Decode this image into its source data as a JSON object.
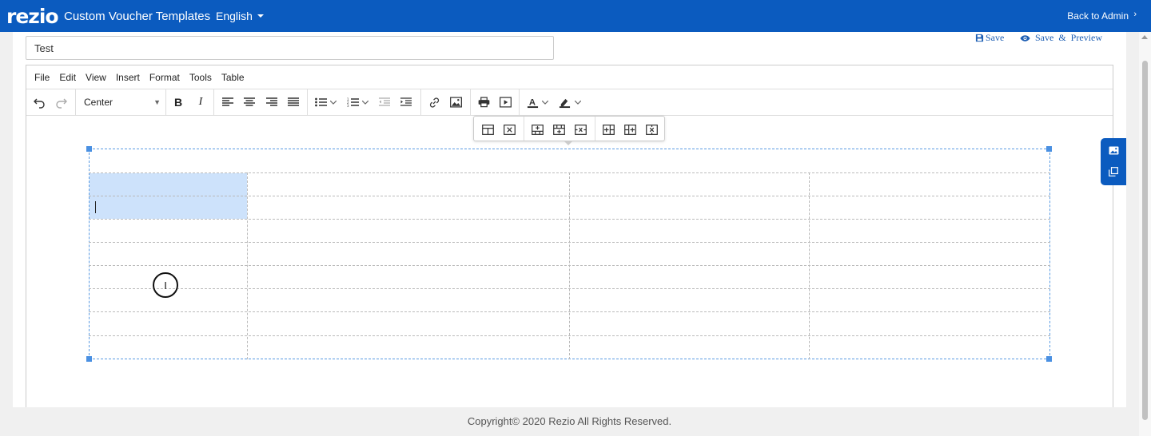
{
  "header": {
    "logo": "rezio",
    "title": "Custom Voucher Templates",
    "language": "English",
    "back_link": "Back to Admin"
  },
  "form": {
    "template_name": "Test",
    "save_label": "Save",
    "preview_label": "Save & Preview"
  },
  "editor": {
    "menu": [
      "File",
      "Edit",
      "View",
      "Insert",
      "Format",
      "Tools",
      "Table"
    ],
    "block_format": "Center",
    "toolbar_icons": [
      "undo-icon",
      "redo-icon",
      "bold-icon",
      "italic-icon",
      "align-left-icon",
      "align-center-icon",
      "align-right-icon",
      "align-justify-icon",
      "bullet-list-icon",
      "numbered-list-icon",
      "outdent-icon",
      "indent-icon",
      "link-icon",
      "image-icon",
      "print-icon",
      "media-icon",
      "text-color-icon",
      "highlight-color-icon"
    ],
    "table_context_icons": [
      "table-properties-icon",
      "delete-table-icon",
      "insert-row-before-icon",
      "insert-row-after-icon",
      "delete-row-icon",
      "insert-column-before-icon",
      "insert-column-after-icon",
      "delete-column-icon"
    ],
    "table": {
      "rows": 9,
      "columns": 4,
      "selected_cells": [
        [
          1,
          0
        ],
        [
          2,
          0
        ]
      ]
    }
  },
  "side_widget_icons": [
    "image-icon",
    "copy-icon"
  ],
  "footer": {
    "copyright": "Copyright© 2020 Rezio All Rights Reserved."
  },
  "colors": {
    "brand": "#0b5bbf",
    "selection": "#cde2fb",
    "link": "#1e5fb4"
  }
}
